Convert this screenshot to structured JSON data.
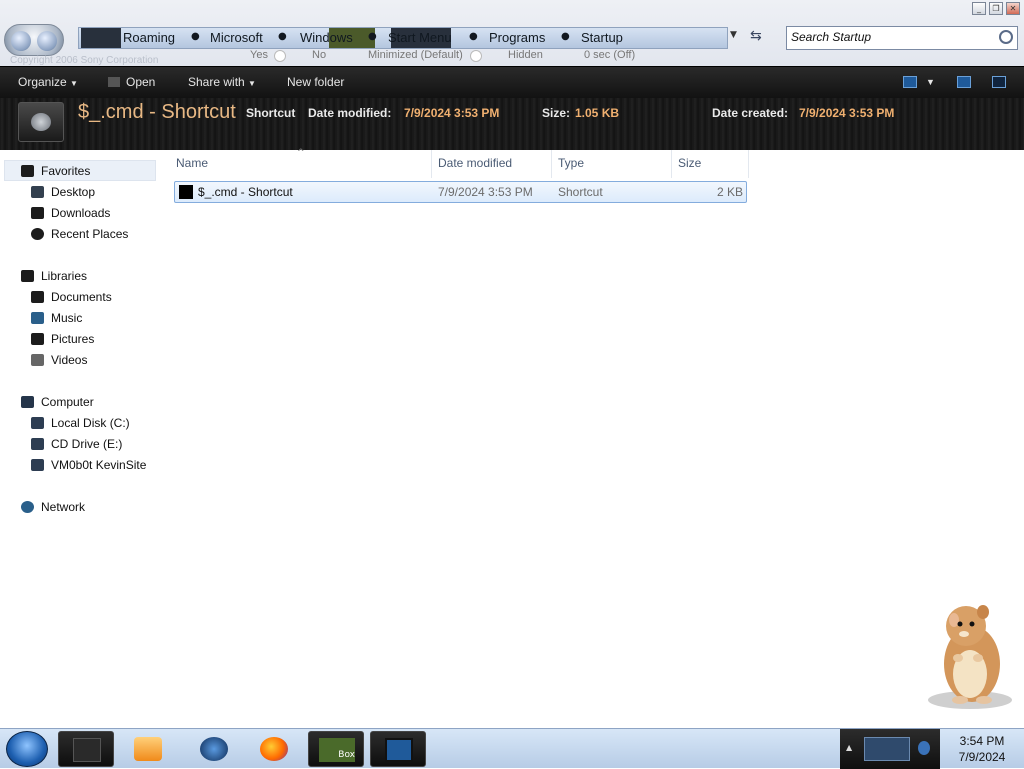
{
  "address": {
    "crumbs": [
      "Roaming",
      "Microsoft",
      "Windows",
      "Start Menu",
      "Programs",
      "Startup"
    ],
    "options_row": [
      "Yes",
      "No",
      "Minimized (Default)",
      "Hidden",
      "0 sec (Off)"
    ],
    "copyright": "Copyright 2006 Sony Corporation"
  },
  "search": {
    "placeholder": "Search Startup"
  },
  "window_controls": {
    "minimize": "_",
    "restore": "❐",
    "close": "✕"
  },
  "toolbar": {
    "organize": "Organize",
    "open": "Open",
    "share_with": "Share with",
    "new_folder": "New folder"
  },
  "details": {
    "title": "$_.cmd - Shortcut",
    "type": "Shortcut",
    "modified_label": "Date modified:",
    "modified_value": "7/9/2024 3:53 PM",
    "size_label": "Size:",
    "size_value": "1.05 KB",
    "created_label": "Date created:",
    "created_value": "7/9/2024 3:53 PM"
  },
  "nav": {
    "favorites": "Favorites",
    "desktop": "Desktop",
    "downloads": "Downloads",
    "recent": "Recent Places",
    "libraries": "Libraries",
    "documents": "Documents",
    "music": "Music",
    "pictures": "Pictures",
    "videos": "Videos",
    "computer": "Computer",
    "local_disk": "Local Disk (C:)",
    "cd_drive": "CD Drive (E:)",
    "vm": "VM0b0t KevinSite",
    "network": "Network"
  },
  "columns": {
    "name": "Name",
    "modified": "Date modified",
    "type": "Type",
    "size": "Size"
  },
  "file": {
    "name": "$_.cmd - Shortcut",
    "modified": "7/9/2024 3:53 PM",
    "type": "Shortcut",
    "size": "2 KB"
  },
  "taskbar": {
    "time": "3:54 PM",
    "date": "7/9/2024",
    "box_label": "Box"
  },
  "colors": {
    "detail_value": "#f0b070",
    "title": "#e8b884",
    "selection": "#dcebfc"
  }
}
